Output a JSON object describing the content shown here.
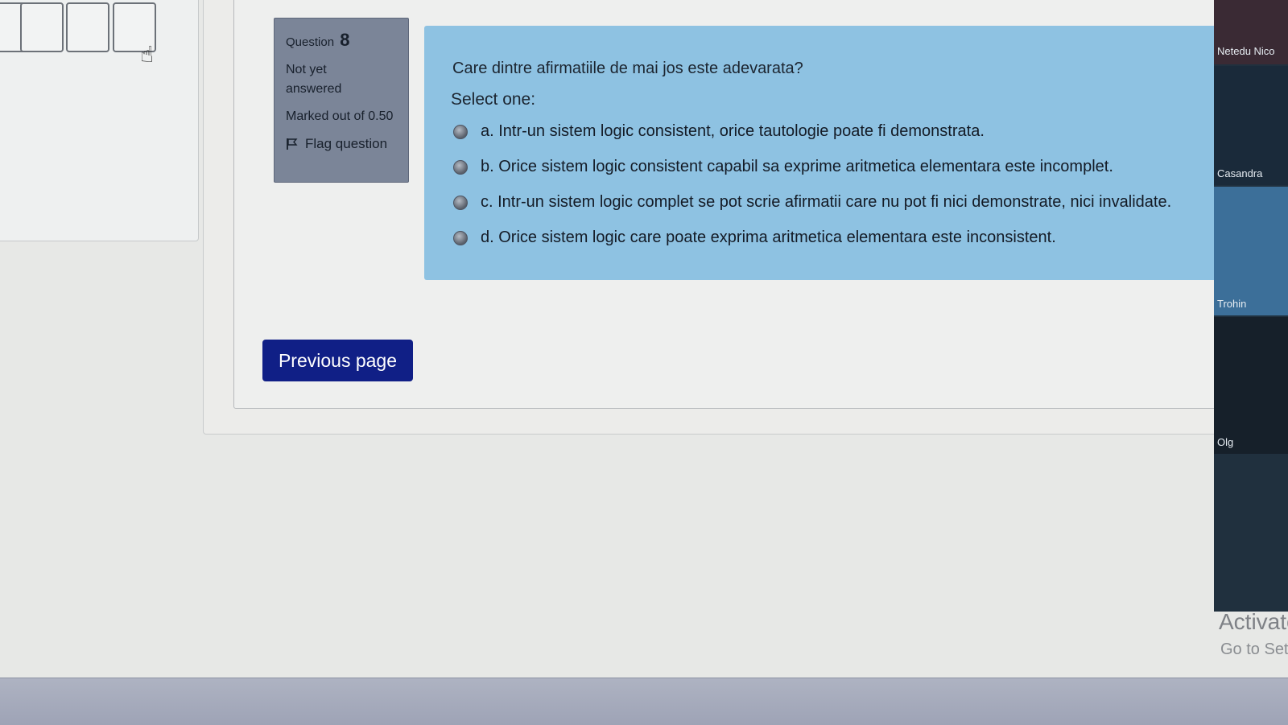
{
  "question_info": {
    "label": "Question",
    "number": "8",
    "state": "Not yet answered",
    "grade": "Marked out of 0.50",
    "flag_label": "Flag question"
  },
  "question": {
    "text": "Care dintre afirmatiile de mai jos este adevarata?",
    "prompt": "Select one:",
    "answers": [
      {
        "label": "a. Intr-un sistem logic consistent, orice tautologie poate fi demonstrata.",
        "selected": false
      },
      {
        "label": "b. Orice sistem logic consistent capabil sa exprime aritmetica elementara este incomplet.",
        "selected": false
      },
      {
        "label": "c. Intr-un sistem logic complet se pot scrie afirmatii care nu pot fi nici demonstrate, nici invalidate.",
        "selected": false
      },
      {
        "label": "d. Orice sistem logic care poate exprima aritmetica elementara este inconsistent.",
        "selected": false
      }
    ]
  },
  "navigation": {
    "previous_label": "Previous page"
  },
  "participants": [
    "Netedu Nico",
    "Casandra",
    "Trohin",
    "Olg"
  ],
  "watermark": {
    "title": "Activate",
    "subtitle": "Go to Sett"
  },
  "colors": {
    "button": "#101f86",
    "info_box": "#7b8598",
    "content_box": "#8ec2e2"
  }
}
